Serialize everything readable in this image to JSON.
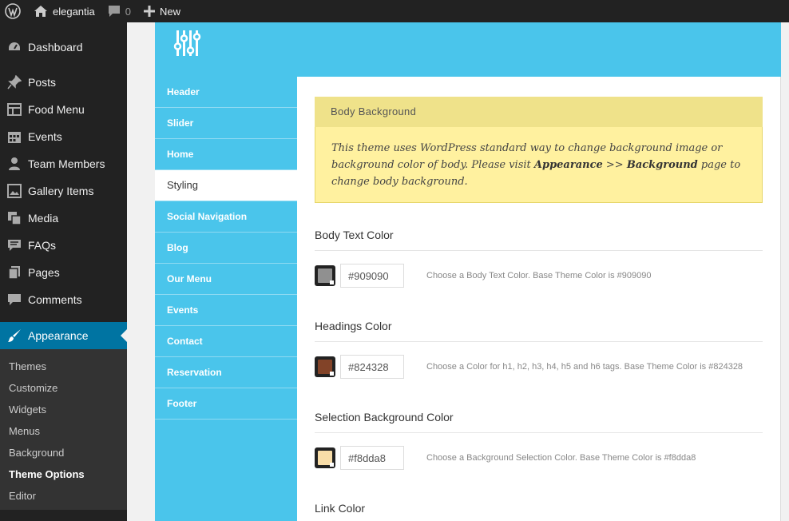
{
  "adminbar": {
    "site_name": "elegantia",
    "comments_count": "0",
    "new_label": "New"
  },
  "menu": {
    "items": [
      {
        "label": "Dashboard",
        "icon": "dashboard-icon"
      },
      {
        "label": "Posts",
        "icon": "pin-icon"
      },
      {
        "label": "Food Menu",
        "icon": "table-icon"
      },
      {
        "label": "Events",
        "icon": "calendar-icon"
      },
      {
        "label": "Team Members",
        "icon": "user-icon"
      },
      {
        "label": "Gallery Items",
        "icon": "gallery-icon"
      },
      {
        "label": "Media",
        "icon": "media-icon"
      },
      {
        "label": "FAQs",
        "icon": "comment-icon"
      },
      {
        "label": "Pages",
        "icon": "pages-icon"
      },
      {
        "label": "Comments",
        "icon": "comments-icon"
      }
    ],
    "current": {
      "label": "Appearance",
      "icon": "brush-icon"
    },
    "submenu": [
      "Themes",
      "Customize",
      "Widgets",
      "Menus",
      "Background",
      "Theme Options",
      "Editor"
    ],
    "submenu_active": "Theme Options"
  },
  "panel": {
    "nav": [
      "Header",
      "Slider",
      "Home",
      "Styling",
      "Social Navigation",
      "Blog",
      "Our Menu",
      "Events",
      "Contact",
      "Reservation",
      "Footer"
    ],
    "nav_active": "Styling",
    "notice": {
      "title": "Body Background",
      "text_1": "This theme uses WordPress standard way to change background image or background color of body. Please visit ",
      "strong_1": "Appearance",
      "text_2": " >> ",
      "strong_2": "Background",
      "text_3": " page to change body background."
    },
    "options": [
      {
        "title": "Body Text Color",
        "value": "#909090",
        "desc": "Choose a Body Text Color. Base Theme Color is #909090"
      },
      {
        "title": "Headings Color",
        "value": "#824328",
        "desc": "Choose a Color for h1, h2, h3, h4, h5 and h6 tags. Base Theme Color is #824328"
      },
      {
        "title": "Selection Background Color",
        "value": "#f8dda8",
        "desc": "Choose a Background Selection Color. Base Theme Color is #f8dda8"
      },
      {
        "title": "Link Color"
      }
    ]
  },
  "colors": {
    "accent": "#4ac5eb",
    "admin_dark": "#222222",
    "wp_blue": "#0074a2",
    "notice_yellow": "#fff19f"
  }
}
